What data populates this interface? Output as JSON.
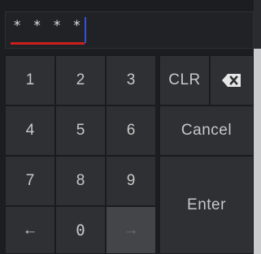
{
  "display": {
    "masked_value": "****"
  },
  "keypad": {
    "k1": "1",
    "k2": "2",
    "k3": "3",
    "k4": "4",
    "k5": "5",
    "k6": "6",
    "k7": "7",
    "k8": "8",
    "k9": "9",
    "k0": "0",
    "left": "←",
    "right": "→",
    "clr": "CLR",
    "cancel": "Cancel",
    "enter": "Enter",
    "backspace_icon": "backspace-icon"
  },
  "colors": {
    "caret": "#3550d8",
    "underline": "#cc1f1f",
    "key_bg": "#2f3034",
    "disabled_key_bg": "#434549"
  }
}
